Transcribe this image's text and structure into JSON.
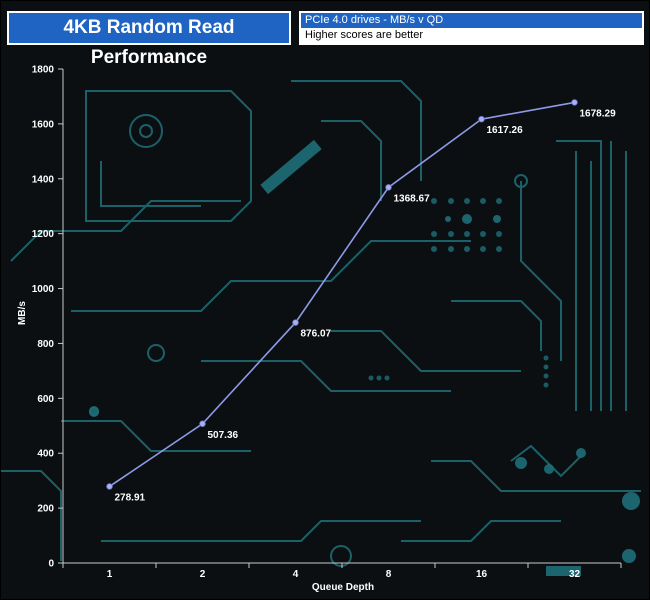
{
  "header": {
    "title": "4KB Random Read Performance",
    "subtitle_line1": "PCIe 4.0 drives - MB/s v QD",
    "subtitle_line2": "Higher scores are better"
  },
  "colors": {
    "background": "#0b0f12",
    "circuit": "#1f6f78",
    "line": "#8e9ae8",
    "title_bg": "#1f64c2",
    "text": "#ffffff"
  },
  "chart_data": {
    "type": "line",
    "categories": [
      "1",
      "2",
      "4",
      "8",
      "16",
      "32"
    ],
    "series": [
      {
        "values": [
          278.91,
          507.36,
          876.07,
          1368.67,
          1617.26,
          1678.29
        ]
      }
    ],
    "data_labels": [
      "278.91",
      "507.36",
      "876.07",
      "1368.67",
      "1617.26",
      "1678.29"
    ],
    "xlabel": "Queue Depth",
    "ylabel": "MB/s",
    "ylim": [
      0,
      1800
    ],
    "yticks": [
      0,
      200,
      400,
      600,
      800,
      1000,
      1200,
      1400,
      1600,
      1800
    ],
    "grid": false
  }
}
